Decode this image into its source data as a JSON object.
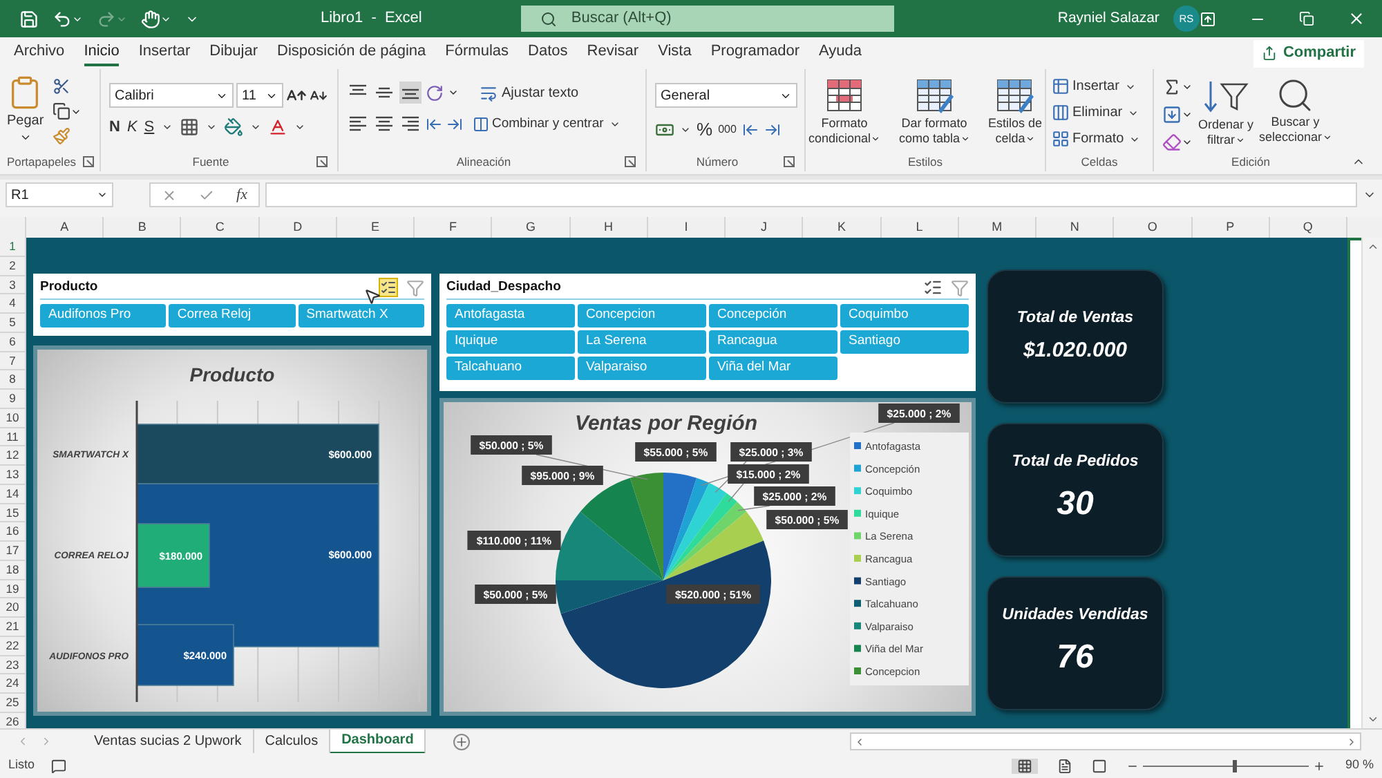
{
  "title_bar": {
    "title": "Libro1  -  Excel",
    "search_placeholder": "Buscar (Alt+Q)",
    "user": "Rayniel Salazar",
    "avatar": "RS"
  },
  "menu_tabs": [
    {
      "label": "Archivo",
      "selected": false
    },
    {
      "label": "Inicio",
      "selected": true
    },
    {
      "label": "Insertar",
      "selected": false
    },
    {
      "label": "Dibujar",
      "selected": false
    },
    {
      "label": "Disposición de página",
      "selected": false
    },
    {
      "label": "Fórmulas",
      "selected": false
    },
    {
      "label": "Datos",
      "selected": false
    },
    {
      "label": "Revisar",
      "selected": false
    },
    {
      "label": "Vista",
      "selected": false
    },
    {
      "label": "Programador",
      "selected": false
    },
    {
      "label": "Ayuda",
      "selected": false
    }
  ],
  "share": "Compartir",
  "ribbon": [
    {
      "kind": "clipboard",
      "label": "Portapapeles",
      "paste": "Pegar"
    },
    {
      "kind": "font",
      "label": "Fuente",
      "font": "Calibri",
      "size": "11",
      "bold": "N",
      "italic": "K",
      "underline": "S"
    },
    {
      "kind": "alignment",
      "label": "Alineación",
      "wrap": "Ajustar texto",
      "merge": "Combinar y centrar"
    },
    {
      "kind": "number",
      "label": "Número",
      "format": "General",
      "percent": "%",
      "thousands": "000"
    },
    {
      "kind": "styles",
      "label": "Estilos",
      "buttons": [
        [
          "Formato",
          "condicional"
        ],
        [
          "Dar formato",
          "como tabla"
        ],
        [
          "Estilos de",
          "celda"
        ]
      ]
    },
    {
      "kind": "cells",
      "label": "Celdas",
      "buttons": [
        "Insertar",
        "Eliminar",
        "Formato"
      ]
    },
    {
      "kind": "editing",
      "label": "Edición",
      "buttons": [
        [
          "Ordenar y",
          "filtrar"
        ],
        [
          "Buscar y",
          "seleccionar"
        ]
      ]
    }
  ],
  "formula_bar": {
    "name_box": "R1",
    "fx": "fx"
  },
  "columns": [
    "A",
    "B",
    "C",
    "D",
    "E",
    "F",
    "G",
    "H",
    "I",
    "J",
    "K",
    "L",
    "M",
    "N",
    "O",
    "P",
    "Q"
  ],
  "rows": [
    "1",
    "2",
    "3",
    "4",
    "5",
    "6",
    "7",
    "8",
    "9",
    "10",
    "11",
    "12",
    "13",
    "14",
    "15",
    "16",
    "17",
    "18",
    "19",
    "20",
    "21",
    "22",
    "23",
    "24",
    "25",
    "26"
  ],
  "dashboard": {
    "product_slicer": {
      "title": "Producto",
      "multi_select": true,
      "items": [
        {
          "label": "Audifonos Pro",
          "selected": true
        },
        {
          "label": "Correa Reloj",
          "selected": true
        },
        {
          "label": "Smartwatch X",
          "selected": true
        }
      ]
    },
    "bar_chart": {
      "chart_data": {
        "type": "bar",
        "orientation": "horizontal",
        "title": "Producto",
        "categories": [
          "SMARTWATCH X",
          "CORREA RELOJ",
          "AUDIFONOS PRO"
        ],
        "series": [
          {
            "color": "#21ad78",
            "values": [
              null,
              180000,
              null
            ],
            "value_labels": [
              null,
              "$180.000",
              null
            ]
          },
          {
            "color": "#15558f",
            "values": [
              null,
              600000,
              240000
            ],
            "value_labels": [
              null,
              "$600.000",
              "$240.000"
            ]
          },
          {
            "color": "#1b4a5f",
            "values": [
              600000,
              null,
              null
            ],
            "value_labels": [
              "$600.000",
              null,
              null
            ]
          }
        ],
        "data_labels": true
      }
    },
    "city_slicer": {
      "title": "Ciudad_Despacho",
      "multi_select": false,
      "items": [
        {
          "label": "Antofagasta",
          "selected": true
        },
        {
          "label": "Concepcion",
          "selected": true
        },
        {
          "label": "Concepción",
          "selected": true
        },
        {
          "label": "Coquimbo",
          "selected": true
        },
        {
          "label": "Iquique",
          "selected": true
        },
        {
          "label": "La Serena",
          "selected": true
        },
        {
          "label": "Rancagua",
          "selected": true
        },
        {
          "label": "Santiago",
          "selected": true
        },
        {
          "label": "Talcahuano",
          "selected": true
        },
        {
          "label": "Valparaiso",
          "selected": true
        },
        {
          "label": "Viña del Mar",
          "selected": true
        }
      ]
    },
    "pie_chart": {
      "chart_data": {
        "type": "pie",
        "title": "Ventas por Región",
        "categories": [
          "Antofagasta",
          "Concepción",
          "Coquimbo",
          "Iquique",
          "La Serena",
          "Rancagua",
          "Santiago",
          "Talcahuano",
          "Valparaiso",
          "Viña del Mar",
          "Concepcion"
        ],
        "colors": [
          "#2271c6",
          "#1fa2d4",
          "#2fd3d3",
          "#2fdb9a",
          "#6fd46a",
          "#a9cf50",
          "#133f6d",
          "#0f5d72",
          "#17877a",
          "#15844e",
          "#3b8f35"
        ],
        "series": [
          {
            "values": [
              5,
              2,
              3,
              2,
              2,
              5,
              51,
              5,
              11,
              9,
              5
            ]
          }
        ],
        "legend": "right",
        "value_labels": [
          "$55.000 ; 5%",
          "$25.000 ; 2%",
          "$25.000 ; 3%",
          "$15.000 ; 2%",
          "$25.000 ; 2%",
          "$50.000 ; 5%",
          "$520.000 ; 51%",
          "$50.000 ; 5%",
          "$110.000 ; 11%",
          "$95.000 ; 9%",
          "$50.000 ; 5%"
        ]
      }
    },
    "kpis": [
      {
        "label": "Total de Ventas",
        "value": "$1.020.000"
      },
      {
        "label": "Total de Pedidos",
        "value": "30"
      },
      {
        "label": "Unidades Vendidas",
        "value": "76"
      }
    ]
  },
  "sheet_tabs": [
    {
      "label": "Ventas sucias 2 Upwork",
      "selected": false
    },
    {
      "label": "Calculos",
      "selected": false
    },
    {
      "label": "Dashboard",
      "selected": true
    }
  ],
  "status_bar": {
    "status": "Listo",
    "zoom": {
      "level": 0.55
    },
    "zoom_label": "90 %"
  }
}
